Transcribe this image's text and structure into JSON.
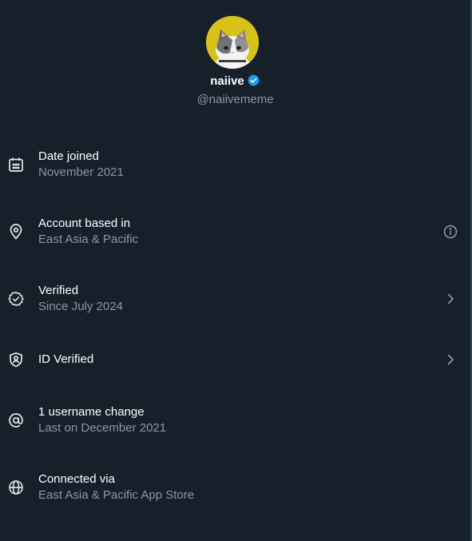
{
  "profile": {
    "display_name": "naiive",
    "verified_badge_icon": "verified-badge-icon",
    "handle": "@naiivememe",
    "avatar_icon": "cat-avatar"
  },
  "rows": [
    {
      "title": "Date joined",
      "subtitle": "November 2021",
      "icon": "calendar-icon",
      "trailing": ""
    },
    {
      "title": "Account based in",
      "subtitle": "East Asia & Pacific",
      "icon": "location-pin-icon",
      "trailing": "info-icon"
    },
    {
      "title": "Verified",
      "subtitle": "Since July 2024",
      "icon": "verified-check-icon",
      "trailing": "chevron-right-icon"
    },
    {
      "title": "ID Verified",
      "subtitle": "",
      "icon": "id-shield-icon",
      "trailing": "chevron-right-icon"
    },
    {
      "title": "1 username change",
      "subtitle": "Last on December 2021",
      "icon": "at-sign-icon",
      "trailing": ""
    },
    {
      "title": "Connected via",
      "subtitle": "East Asia & Pacific App Store",
      "icon": "globe-icon",
      "trailing": ""
    }
  ],
  "colors": {
    "background": "#15202b",
    "text_primary": "#ffffff",
    "text_secondary": "#8b98a5",
    "badge_blue": "#1d9bf0",
    "avatar_bg": "#d8c21a"
  }
}
